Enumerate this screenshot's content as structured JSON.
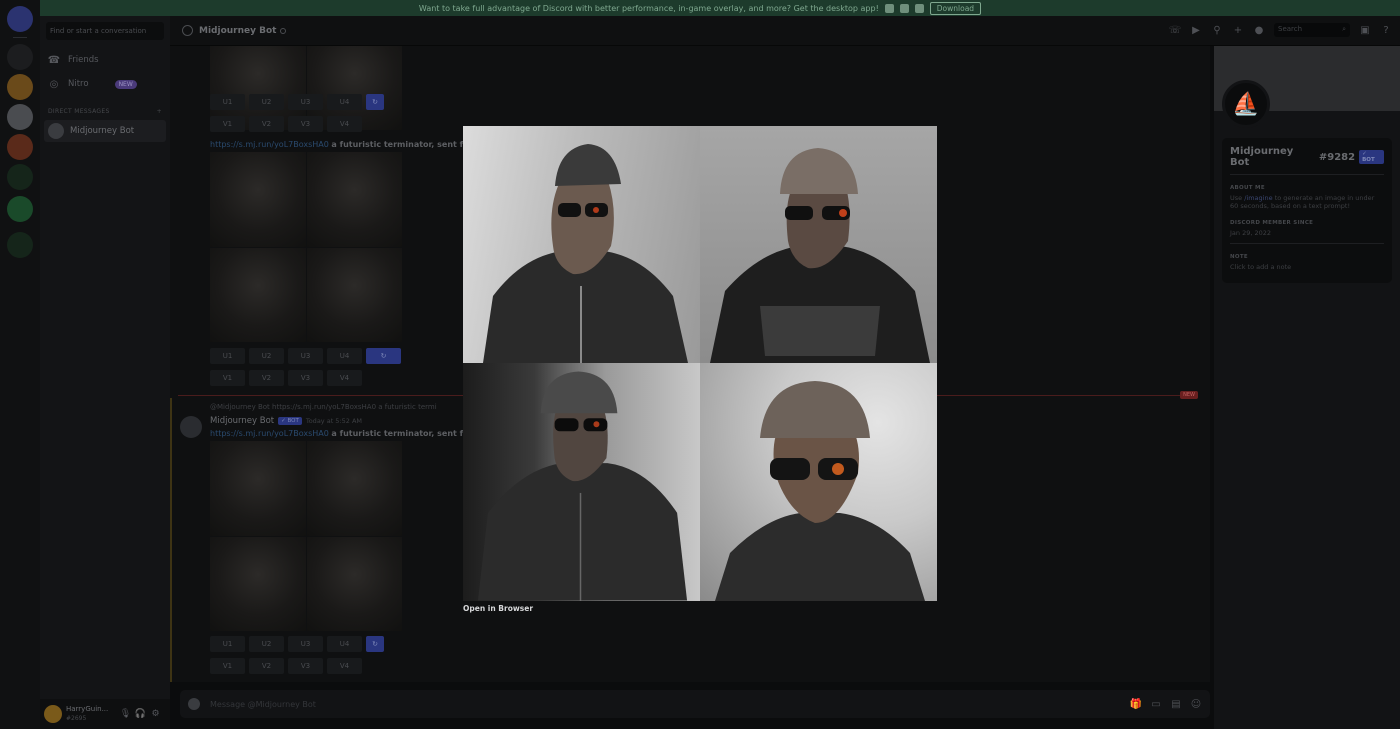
{
  "banner": {
    "text": "Want to take full advantage of Discord with better performance, in-game overlay, and more? Get the desktop app!",
    "download_label": "Download"
  },
  "sidebar": {
    "search_placeholder": "Find or start a conversation",
    "friends_label": "Friends",
    "nitro_label": "Nitro",
    "new_badge": "NEW",
    "dm_header": "DIRECT MESSAGES",
    "dm_add": "+",
    "dm_item": "Midjourney Bot"
  },
  "user_panel": {
    "name": "HarryGuin...",
    "tag": "#2695"
  },
  "header": {
    "channel_name": "Midjourney Bot",
    "search_placeholder": "Search"
  },
  "messages": {
    "upscale_labels": [
      "U1",
      "U2",
      "U3",
      "U4"
    ],
    "variation_labels": [
      "V1",
      "V2",
      "V3",
      "V4"
    ],
    "refresh_icon": "↻",
    "link_text": "https://s.mj.run/yoL7BoxsHA0",
    "prompt_text": "a futuristic terminator, sent from",
    "reply_text": "@Midjourney Bot https://s.mj.run/yoL7BoxsHA0 a futuristic termi",
    "author": "Midjourney Bot",
    "bot_badge": "✓ BOT",
    "timestamp": "Today at 5:52 AM",
    "new_label": "NEW",
    "composer_placeholder": "Message @Midjourney Bot"
  },
  "profile": {
    "username": "Midjourney Bot",
    "discriminator": "#9282",
    "bot_badge": "✓ BOT",
    "about_header": "ABOUT ME",
    "about_cmd": "/imagine",
    "about_prefix": "Use",
    "about_rest": "to generate an image in under 60 seconds, based on a text prompt!",
    "member_header": "DISCORD MEMBER SINCE",
    "member_since": "Jan 29, 2022",
    "note_header": "NOTE",
    "note_placeholder": "Click to add a note"
  },
  "lightbox": {
    "open_label": "Open in Browser"
  },
  "colors": {
    "accent": "#5865f2",
    "banner_bg": "#1d3b2c",
    "new_red": "#ed4245"
  }
}
